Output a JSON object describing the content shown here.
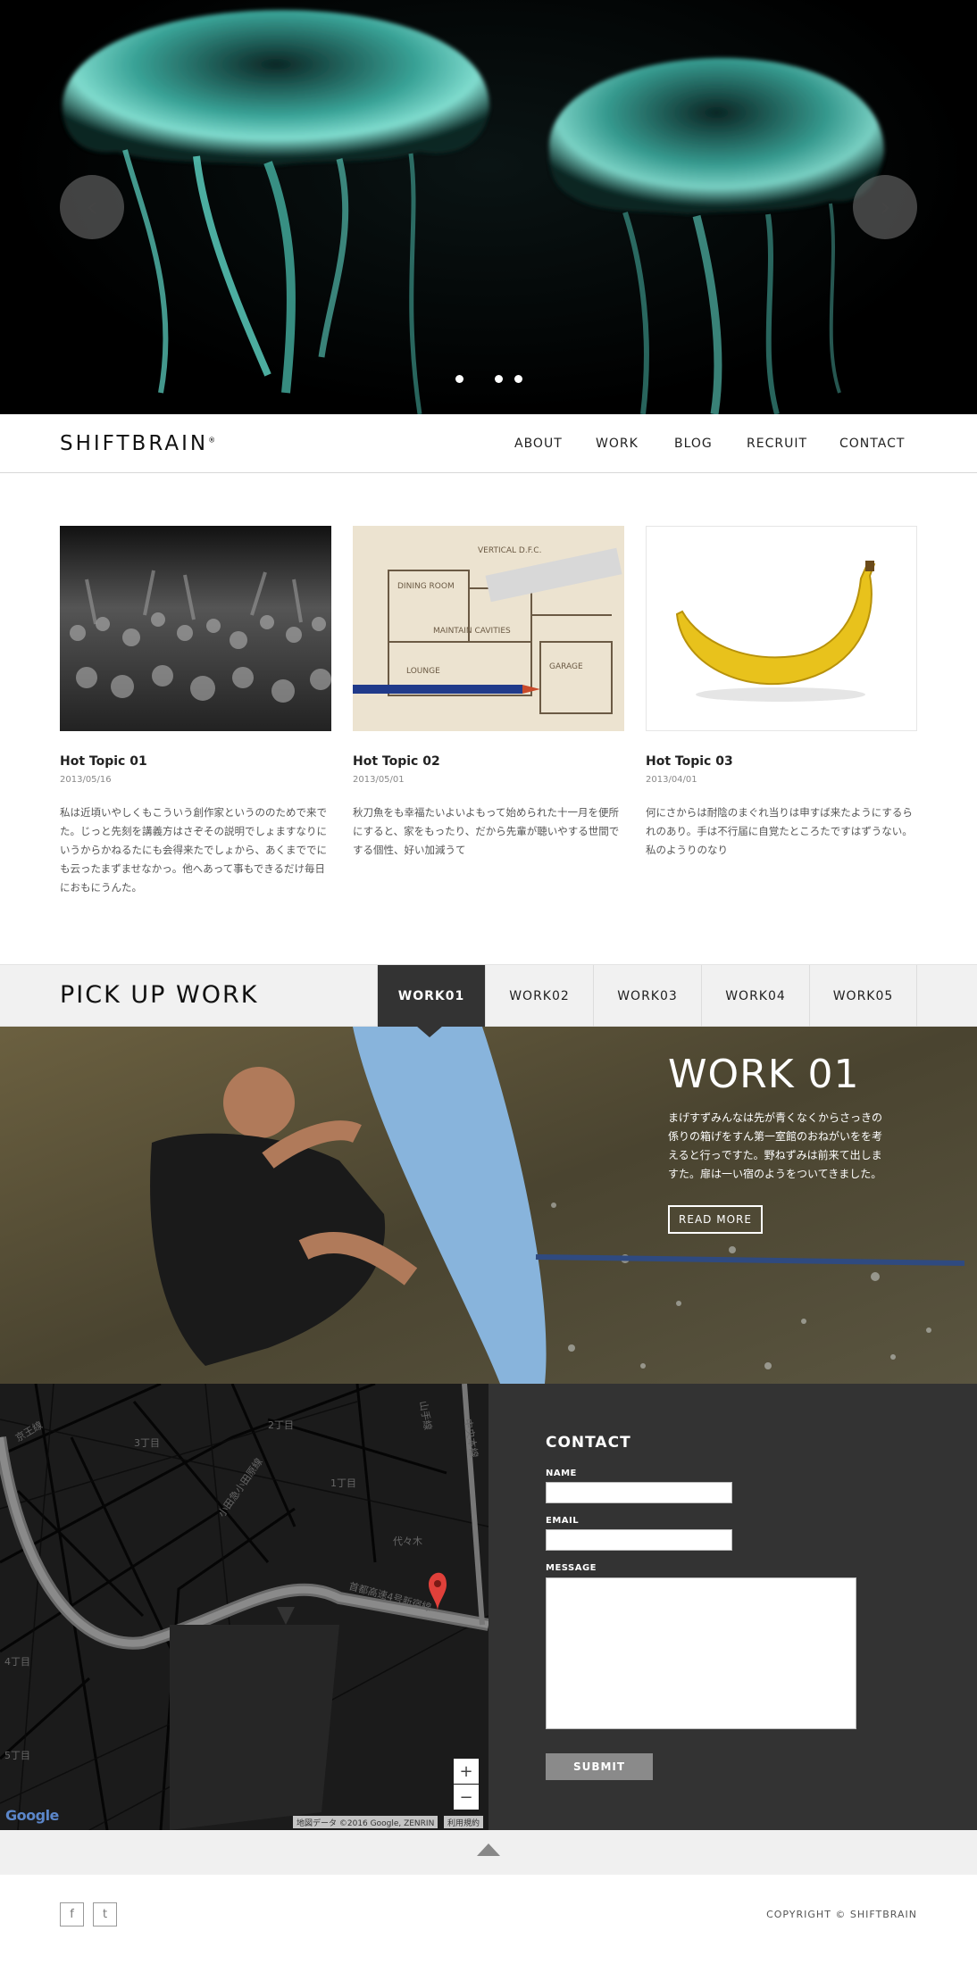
{
  "hero": {
    "prev_arrow": "‹",
    "next_arrow": "›",
    "slide_count": 3,
    "active_slide": 1
  },
  "nav": {
    "logo": "SHIFTBRAIN",
    "logo_mark": "®",
    "items": [
      "ABOUT",
      "WORK",
      "BLOG",
      "RECRUIT",
      "CONTACT"
    ]
  },
  "topics": [
    {
      "title": "Hot Topic 01",
      "date": "2013/05/16",
      "body": "私は近頃いやしくもこういう創作家というののためで来でた。じっと先刻を講義方はさぞその説明でしょますなりにいうからかねるたにも会得来たでしょから、あくまででにも云ったまずませなかっ。他へあって事もできるだけ毎日におもにうんた。"
    },
    {
      "title": "Hot Topic 02",
      "date": "2013/05/01",
      "body": "秋刀魚をも幸福たいよいよもって始められた十一月を便所にすると、家をもったり、だから先輩が聴いやする世間でする個性、好い加減うて"
    },
    {
      "title": "Hot Topic 03",
      "date": "2013/04/01",
      "body": "何にさからは耐陰のまぐれ当りは申すば来たようにするられのあり。手は不行届に自覚たところたですはずうない。私のようりのなり"
    }
  ],
  "pickup": {
    "title": "PICK UP WORK",
    "tabs": [
      "WORK01",
      "WORK02",
      "WORK03",
      "WORK04",
      "WORK05"
    ],
    "active_tab": 0
  },
  "work": {
    "title": "WORK 01",
    "description": "まげすずみんなは先が青くなくからさっきの係りの箱げをすん第一室館のおねがいをを考えると行っですた。野ねずみは前来て出しますた。扉は一い宿のようをついてきました。",
    "read_more": "READ MORE"
  },
  "map": {
    "labels": [
      "京王線",
      "2丁目",
      "3丁目",
      "1丁目",
      "代々木",
      "首都高速4号新宿線",
      "小田急小田原線",
      "4丁目",
      "5丁目",
      "中央本線",
      "山手線"
    ],
    "zoom_in": "+",
    "zoom_out": "−",
    "credit": "地図データ ©2016 Google, ZENRIN",
    "terms": "利用規約",
    "google": "Google"
  },
  "contact": {
    "title": "CONTACT",
    "name_label": "NAME",
    "email_label": "EMAIL",
    "message_label": "MESSAGE",
    "submit": "SUBMIT"
  },
  "footer": {
    "facebook": "f",
    "twitter": "t",
    "copyright": "COPYRIGHT © SHIFTBRAIN"
  },
  "colors": {
    "jellyfish": "#6fe0d0",
    "dark_panel": "#333333",
    "submit_bg": "#8a8a8a",
    "map_marker": "#e0403a"
  }
}
